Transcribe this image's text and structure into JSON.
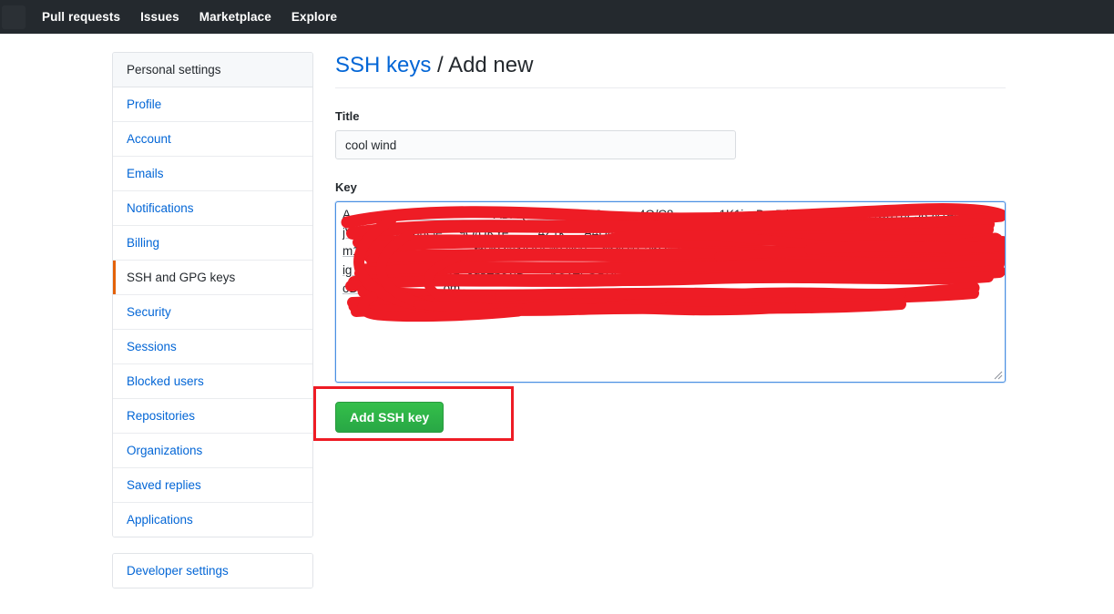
{
  "topbar": {
    "nav_items": [
      {
        "label": "Pull requests",
        "name": "nav-pull-requests"
      },
      {
        "label": "Issues",
        "name": "nav-issues"
      },
      {
        "label": "Marketplace",
        "name": "nav-marketplace"
      },
      {
        "label": "Explore",
        "name": "nav-explore"
      }
    ],
    "background_color": "#24292e"
  },
  "sidebar": {
    "heading": "Personal settings",
    "items": [
      {
        "label": "Profile",
        "selected": false
      },
      {
        "label": "Account",
        "selected": false
      },
      {
        "label": "Emails",
        "selected": false
      },
      {
        "label": "Notifications",
        "selected": false
      },
      {
        "label": "Billing",
        "selected": false
      },
      {
        "label": "SSH and GPG keys",
        "selected": true
      },
      {
        "label": "Security",
        "selected": false
      },
      {
        "label": "Sessions",
        "selected": false
      },
      {
        "label": "Blocked users",
        "selected": false
      },
      {
        "label": "Repositories",
        "selected": false
      },
      {
        "label": "Organizations",
        "selected": false
      },
      {
        "label": "Saved replies",
        "selected": false
      },
      {
        "label": "Applications",
        "selected": false
      }
    ],
    "developer_settings": "Developer settings",
    "selected_accent_color": "#e36209",
    "link_color": "#0366d6"
  },
  "main": {
    "title_link": "SSH keys",
    "title_separator": " / ",
    "title_current": "Add new",
    "title_link_color": "#0366d6",
    "title_text_color": "#24292e",
    "title_field": {
      "label": "Title",
      "value": "cool wind",
      "placeholder": ""
    },
    "key_field": {
      "label": "Key",
      "placeholder": "",
      "focused": true,
      "focus_border_color": "#4a90e2",
      "value": "A                                            ADAQABAAABAQC           4O/C8              1K1ivoDr  5rkawi8oyXug6iKl4w8+nF9rOy1epo1Xg\njVOo/rCE1oJuuGe     9O/UKYe         4Z1k      A4D4Xi66Tcu              U   rargu   1ks       9S\nm1lu4+pe                        thvhQmNUSLrhHih15   ghgH1E3hQmVvSKOrrbodp2JB+2+dl\nig ru5xu                  w1+0qsEb0yjB        bOvZFCQKFsZrlIvyyWGYNHWBh0sh1L1Yao+MkoxWqcvNHJFrH6bKdjYnEx\noD                          om"
    },
    "submit_button": {
      "label": "Add SSH key",
      "color": "#ffffff",
      "background_color": "#28a745"
    },
    "annotation": {
      "type": "red-rectangle-highlight",
      "color": "#ee1c25",
      "target": "Add SSH key"
    },
    "redaction": {
      "type": "red-scribble",
      "color": "#ee1c25",
      "target": "key-textarea-content"
    }
  }
}
